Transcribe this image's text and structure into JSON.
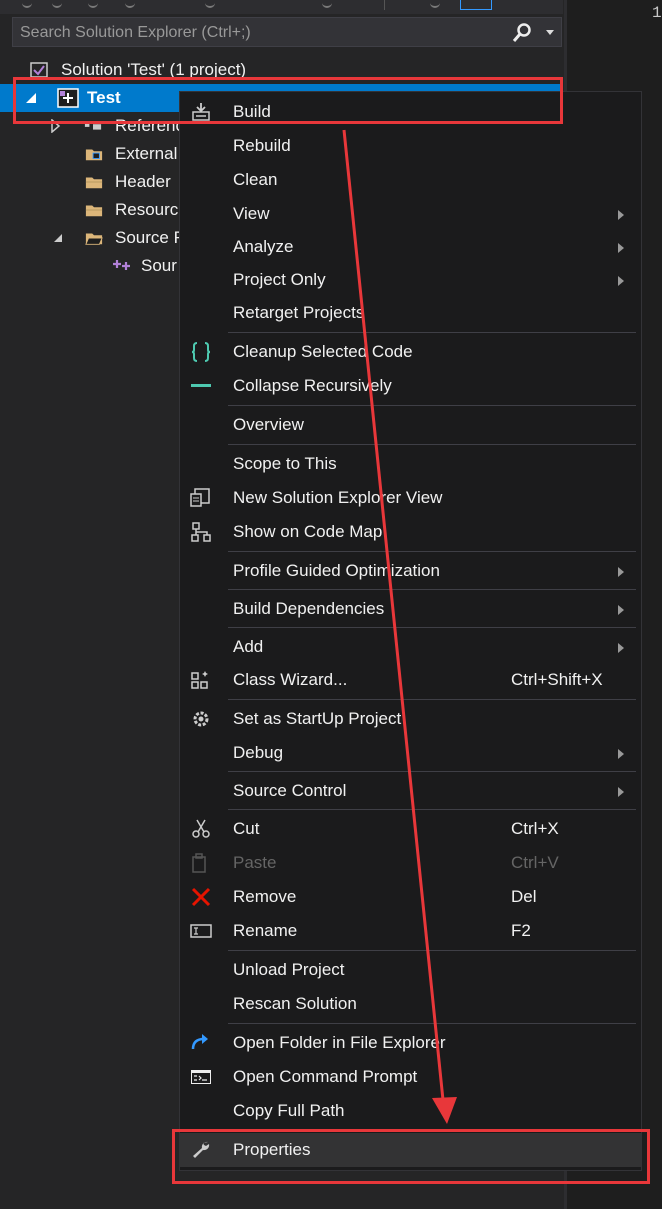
{
  "search": {
    "placeholder": "Search Solution Explorer (Ctrl+;)"
  },
  "editor": {
    "line_number": "1"
  },
  "tree": {
    "solution": "Solution 'Test' (1 project)",
    "project": "Test",
    "items": [
      {
        "label": "Referenc"
      },
      {
        "label": "External"
      },
      {
        "label": "Header"
      },
      {
        "label": "Resourc"
      },
      {
        "label": "Source F"
      },
      {
        "label": "Sour"
      }
    ]
  },
  "menu": {
    "items": [
      {
        "label": "Build",
        "icon": "build-icon"
      },
      {
        "label": "Rebuild"
      },
      {
        "label": "Clean"
      },
      {
        "label": "View",
        "submenu": true
      },
      {
        "label": "Analyze",
        "submenu": true
      },
      {
        "label": "Project Only",
        "submenu": true
      },
      {
        "label": "Retarget Projects"
      },
      {
        "label": "Cleanup Selected Code",
        "icon": "braces-icon"
      },
      {
        "label": "Collapse Recursively",
        "icon": "collapse-icon"
      },
      {
        "label": "Overview"
      },
      {
        "label": "Scope to This"
      },
      {
        "label": "New Solution Explorer View",
        "icon": "new-view-icon"
      },
      {
        "label": "Show on Code Map",
        "icon": "code-map-icon"
      },
      {
        "label": "Profile Guided Optimization",
        "submenu": true
      },
      {
        "label": "Build Dependencies",
        "submenu": true
      },
      {
        "label": "Add",
        "submenu": true
      },
      {
        "label": "Class Wizard...",
        "shortcut": "Ctrl+Shift+X",
        "icon": "class-wizard-icon"
      },
      {
        "label": "Set as StartUp Project",
        "icon": "gear-icon"
      },
      {
        "label": "Debug",
        "submenu": true
      },
      {
        "label": "Source Control",
        "submenu": true
      },
      {
        "label": "Cut",
        "shortcut": "Ctrl+X",
        "icon": "scissors-icon"
      },
      {
        "label": "Paste",
        "shortcut": "Ctrl+V",
        "icon": "paste-icon",
        "disabled": true
      },
      {
        "label": "Remove",
        "shortcut": "Del",
        "icon": "remove-icon"
      },
      {
        "label": "Rename",
        "shortcut": "F2",
        "icon": "rename-icon"
      },
      {
        "label": "Unload Project"
      },
      {
        "label": "Rescan Solution"
      },
      {
        "label": "Open Folder in File Explorer",
        "icon": "refresh-arrow-icon"
      },
      {
        "label": "Open Command Prompt",
        "icon": "command-prompt-icon"
      },
      {
        "label": "Copy Full Path"
      },
      {
        "label": "Properties",
        "icon": "wrench-icon"
      }
    ]
  },
  "colors": {
    "selection": "#007acc",
    "annotation": "#e8373a",
    "menu_bg": "#1b1b1c",
    "panel_bg": "#252526"
  }
}
